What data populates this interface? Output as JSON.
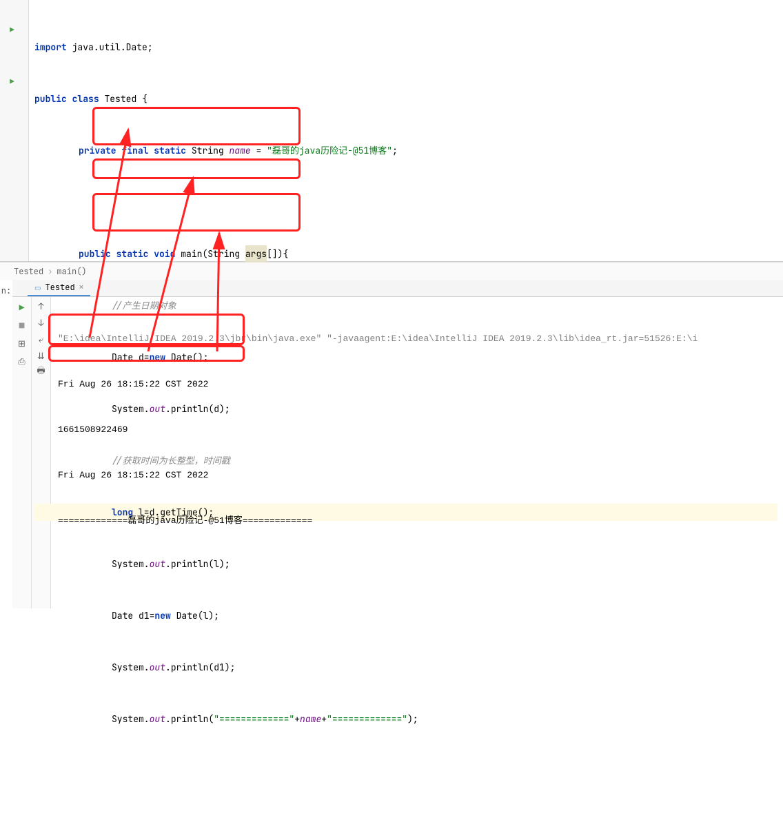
{
  "code": {
    "import_kw": "import",
    "import_pkg": " java.util.Date;",
    "public_kw": "public",
    "class_kw": "class",
    "class_name": " Tested {",
    "private_kw": "private",
    "final_kw": "final",
    "static_kw": "static",
    "string_type": " String ",
    "name_field": "name",
    "equals": " = ",
    "name_value": "\"磊哥的java历险记-@51博客\"",
    "semicolon": ";",
    "void_kw": "void",
    "main_sig1": " main(String ",
    "args": "args",
    "main_sig2": "[]){",
    "comment1": "//产生日期对象",
    "date_type": "Date d=",
    "new_kw": "new",
    "date_call": " Date();",
    "sout": "System.",
    "out_field": "out",
    "println_d": ".println(d);",
    "comment2": "//获取时间为长整型，时间戳",
    "long_kw": "long",
    "long_line": " l=d.getTime();",
    "println_l": ".println(l);",
    "date1_decl": "Date d1=",
    "date1_call": " Date(l);",
    "println_d1": ".println(d1);",
    "println_name1": ".println(",
    "str_eq1": "\"=============\"",
    "plus": "+",
    "str_eq2": "\"=============\"",
    "println_name2": ");"
  },
  "breadcrumb": {
    "class": "Tested",
    "method": "main()"
  },
  "run": {
    "label": "n:",
    "tab_name": "Tested",
    "cmd": "\"E:\\idea\\IntelliJ IDEA 2019.2.3\\jbr\\bin\\java.exe\" \"-javaagent:E:\\idea\\IntelliJ IDEA 2019.2.3\\lib\\idea_rt.jar=51526:E:\\i",
    "out1": "Fri Aug 26 18:15:22 CST 2022",
    "out2": "1661508922469",
    "out3": "Fri Aug 26 18:15:22 CST 2022",
    "out4": "=============磊哥的java历险记-@51博客============="
  }
}
